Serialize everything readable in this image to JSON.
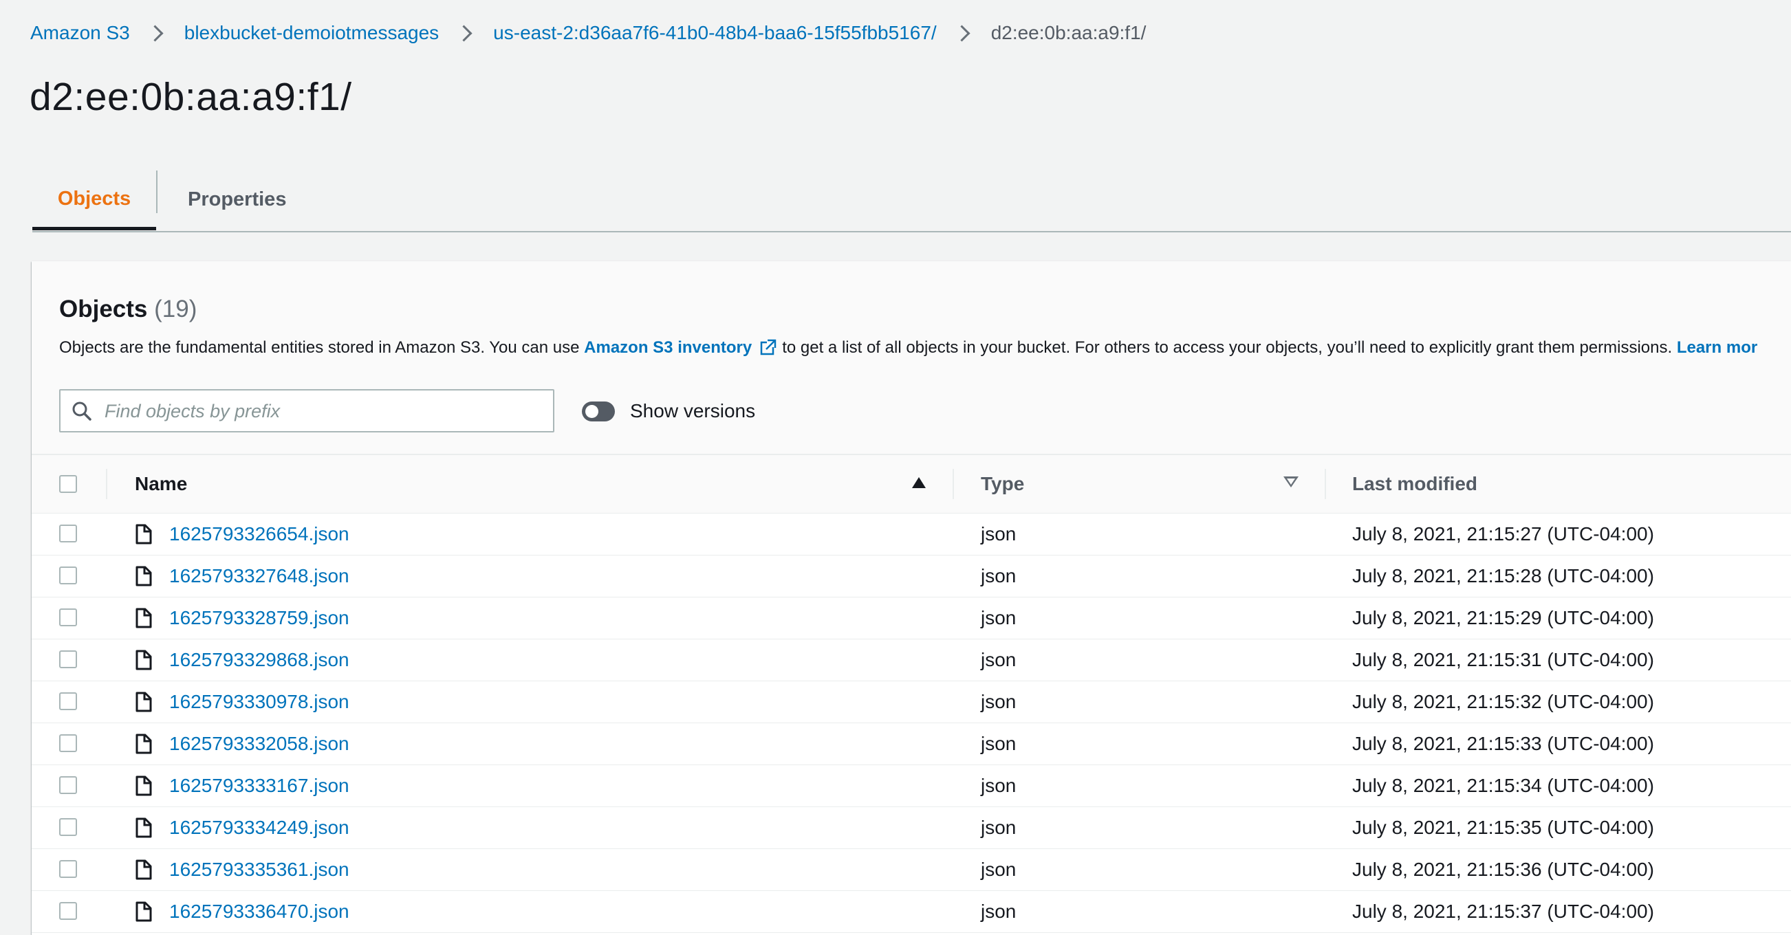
{
  "breadcrumbs": [
    {
      "label": "Amazon S3"
    },
    {
      "label": "blexbucket-demoiotmessages"
    },
    {
      "label": "us-east-2:d36aa7f6-41b0-48b4-baa6-15f55fbb5167/"
    },
    {
      "label": "d2:ee:0b:aa:a9:f1/"
    }
  ],
  "page_title": "d2:ee:0b:aa:a9:f1/",
  "tabs": [
    {
      "label": "Objects",
      "active": true
    },
    {
      "label": "Properties",
      "active": false
    }
  ],
  "objects_panel": {
    "title": "Objects",
    "count": "(19)",
    "description_before": "Objects are the fundamental entities stored in Amazon S3. You can use",
    "inventory_link": "Amazon S3 inventory",
    "description_after": "to get a list of all objects in your bucket. For others to access your objects, you’ll need to explicitly grant them permissions.",
    "learn_more": "Learn mor",
    "search_placeholder": "Find objects by prefix",
    "show_versions_label": "Show versions",
    "show_versions_on": false
  },
  "table": {
    "columns": [
      "Name",
      "Type",
      "Last modified"
    ],
    "sorted_by": "Name",
    "sort_direction": "ascending",
    "rows": [
      {
        "name": "1625793326654.json",
        "type": "json",
        "last_modified": "July 8, 2021, 21:15:27 (UTC-04:00)"
      },
      {
        "name": "1625793327648.json",
        "type": "json",
        "last_modified": "July 8, 2021, 21:15:28 (UTC-04:00)"
      },
      {
        "name": "1625793328759.json",
        "type": "json",
        "last_modified": "July 8, 2021, 21:15:29 (UTC-04:00)"
      },
      {
        "name": "1625793329868.json",
        "type": "json",
        "last_modified": "July 8, 2021, 21:15:31 (UTC-04:00)"
      },
      {
        "name": "1625793330978.json",
        "type": "json",
        "last_modified": "July 8, 2021, 21:15:32 (UTC-04:00)"
      },
      {
        "name": "1625793332058.json",
        "type": "json",
        "last_modified": "July 8, 2021, 21:15:33 (UTC-04:00)"
      },
      {
        "name": "1625793333167.json",
        "type": "json",
        "last_modified": "July 8, 2021, 21:15:34 (UTC-04:00)"
      },
      {
        "name": "1625793334249.json",
        "type": "json",
        "last_modified": "July 8, 2021, 21:15:35 (UTC-04:00)"
      },
      {
        "name": "1625793335361.json",
        "type": "json",
        "last_modified": "July 8, 2021, 21:15:36 (UTC-04:00)"
      },
      {
        "name": "1625793336470.json",
        "type": "json",
        "last_modified": "July 8, 2021, 21:15:37 (UTC-04:00)"
      }
    ]
  },
  "icons": {
    "breadcrumb_separator": "chevron-right-icon",
    "search": "search-icon",
    "external_link": "external-link-icon",
    "file": "file-icon",
    "sort_ascending": "sort-ascending-icon",
    "sort_unsorted": "sort-descending-outline-icon"
  },
  "colors": {
    "link": "#0073bb",
    "active_tab": "#ec7211",
    "page_background": "#f2f3f3",
    "text": "#16191f",
    "muted": "#545b64"
  }
}
